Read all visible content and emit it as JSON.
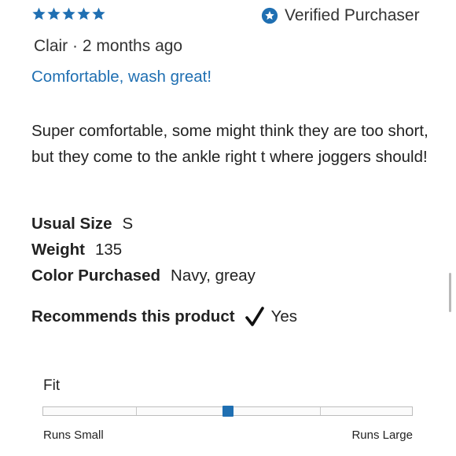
{
  "review": {
    "rating": 5,
    "rating_max": 5,
    "verified_label": "Verified Purchaser",
    "author": "Clair",
    "separator": "·",
    "date": "2 months ago",
    "title": "Comfortable, wash great!",
    "body": "Super comfortable, some might think they are too short, but they come to the ankle right t where joggers should!",
    "attributes": [
      {
        "label": "Usual Size",
        "value": "S"
      },
      {
        "label": "Weight",
        "value": "135"
      },
      {
        "label": "Color Purchased",
        "value": "Navy, greay"
      }
    ],
    "recommends": {
      "label": "Recommends this product",
      "value": "Yes",
      "icon": "checkmark-icon"
    },
    "fit": {
      "label": "Fit",
      "min_label": "Runs Small",
      "max_label": "Runs Large",
      "value_fraction": 0.5
    }
  },
  "colors": {
    "accent": "#1f6fb2",
    "star": "#1f6fb2"
  }
}
